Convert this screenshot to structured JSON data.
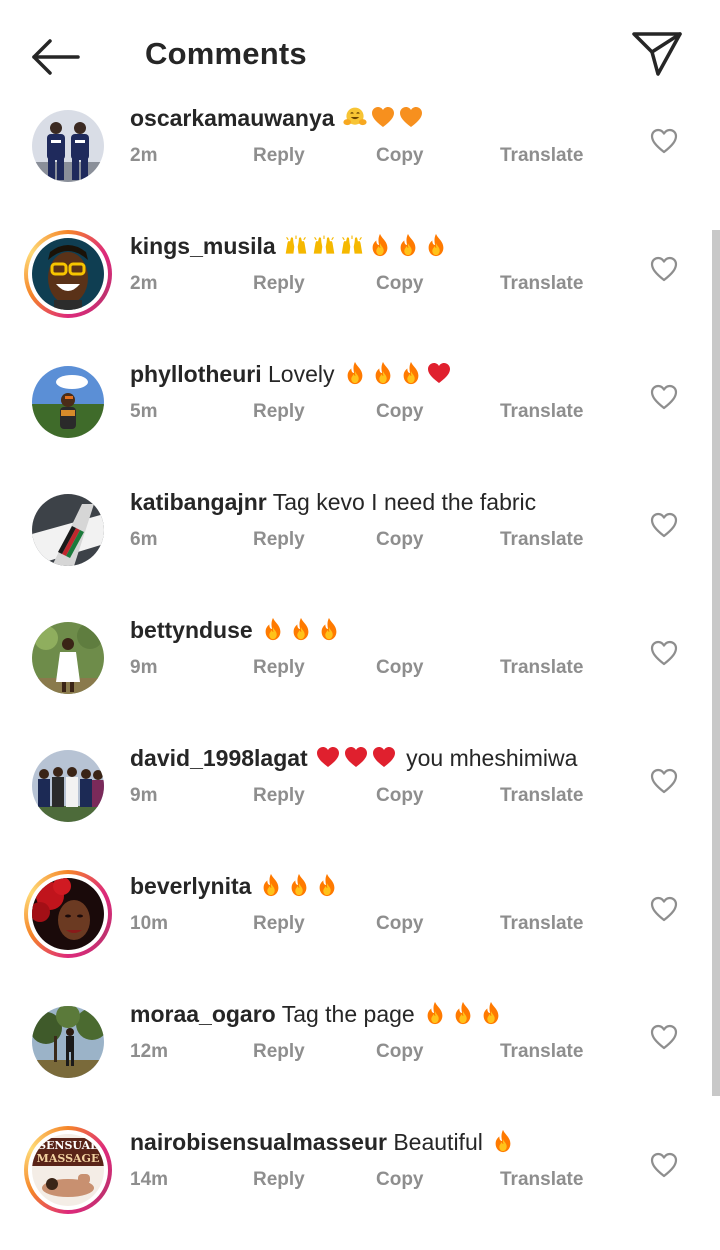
{
  "header": {
    "title": "Comments"
  },
  "actions": {
    "reply": "Reply",
    "copy": "Copy",
    "translate": "Translate"
  },
  "colors": {
    "text": "#262626",
    "meta": "#8e8e8e",
    "story_ring_start": "#f58529",
    "story_ring_end": "#dd2a7b",
    "heart_outline": "#8e8e8e",
    "fire": "#ff7a00",
    "red_heart": "#e0202e",
    "orange_heart": "#f7901e",
    "raising_hands": "#f5b800"
  },
  "comments": [
    {
      "username": "oscarkamauwanya",
      "text": "",
      "emojis": [
        "hugging-face",
        "orange-heart",
        "orange-heart"
      ],
      "time": "2m",
      "has_story": false,
      "avatar": "two-men-in-navy-outfits"
    },
    {
      "username": "kings_musila",
      "text": "",
      "emojis": [
        "raising-hands",
        "raising-hands",
        "raising-hands",
        "fire",
        "fire",
        "fire"
      ],
      "time": "2m",
      "has_story": true,
      "avatar": "laughing-man-with-glasses"
    },
    {
      "username": "phyllotheuri",
      "text": "Lovely",
      "emojis": [
        "fire",
        "fire",
        "fire",
        "red-heart"
      ],
      "time": "5m",
      "has_story": false,
      "avatar": "woman-outdoors-blue-sky"
    },
    {
      "username": "katibangajnr",
      "text": "Tag kevo I need the fabric",
      "emojis": [],
      "time": "6m",
      "has_story": false,
      "avatar": "airplane-tail"
    },
    {
      "username": "bettynduse",
      "text": "",
      "emojis": [
        "fire",
        "fire",
        "fire"
      ],
      "time": "9m",
      "has_story": false,
      "avatar": "woman-in-white-garden"
    },
    {
      "username": "david_1998lagat",
      "text": "you mheshimiwa",
      "emojis": [
        "red-heart",
        "red-heart",
        "red-heart"
      ],
      "emoji_first": true,
      "time": "9m",
      "has_story": false,
      "avatar": "group-of-men-in-suits"
    },
    {
      "username": "beverlynita",
      "text": "",
      "emojis": [
        "fire",
        "fire",
        "fire"
      ],
      "time": "10m",
      "has_story": true,
      "avatar": "woman-with-red-flowers"
    },
    {
      "username": "moraa_ogaro",
      "text": "Tag the page",
      "emojis": [
        "fire",
        "fire",
        "fire"
      ],
      "time": "12m",
      "has_story": false,
      "avatar": "woman-in-forest"
    },
    {
      "username": "nairobisensualmasseur",
      "text": "Beautiful",
      "emojis": [
        "fire"
      ],
      "time": "14m",
      "has_story": true,
      "avatar": "massage-logo",
      "avatar_text": [
        "SENSUAL",
        "MASSAGE"
      ]
    }
  ]
}
